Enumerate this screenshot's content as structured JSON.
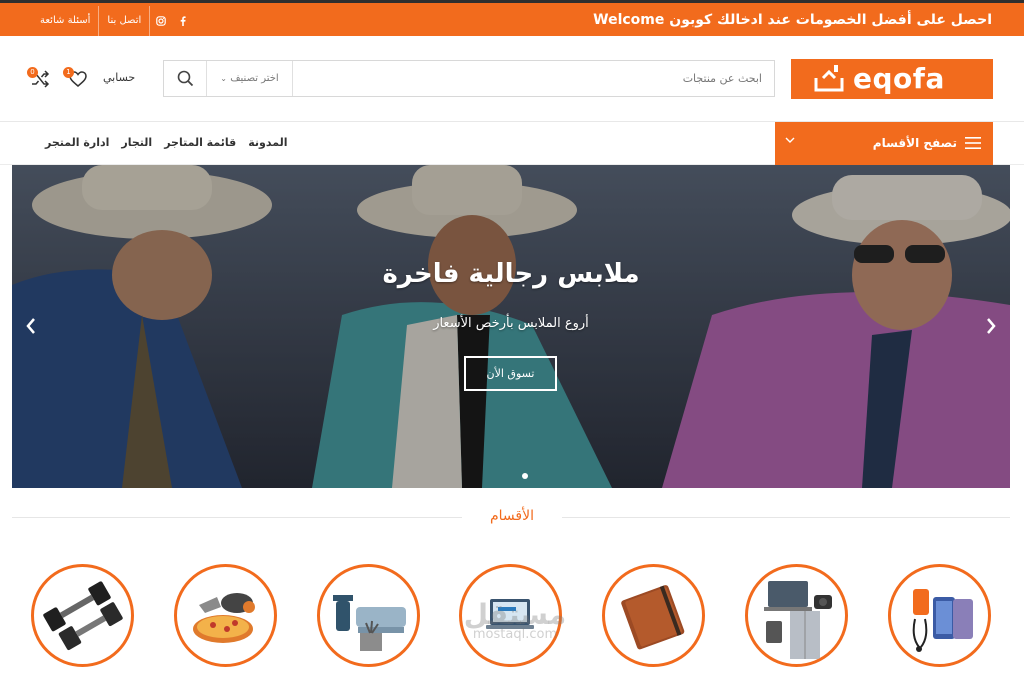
{
  "topbar": {
    "promo": "احصل على أفضل الخصومات عند ادخالك كوبون Welcome",
    "links": [
      "أسئلة شائعة",
      "اتصل بنا"
    ],
    "social_icons": [
      "instagram-icon",
      "facebook-icon"
    ]
  },
  "header": {
    "logo_text": "eqofa",
    "search_placeholder": "ابحث عن منتجات",
    "category_select": "اختر تصنيف",
    "account_label": "حسابي",
    "wishlist_count": "1",
    "compare_count": "0"
  },
  "nav": {
    "browse_label": "تصفح الأقسام",
    "items": [
      "ادارة المتجر",
      "التجار",
      "قائمة المتاجر",
      "المدونة"
    ]
  },
  "hero": {
    "title": "ملابس رجالية فاخرة",
    "subtitle": "أروع الملابس بأرخص الأسعار",
    "cta": "تسوق الأن"
  },
  "sections": {
    "categories_title": "الأقسام"
  },
  "categories": [
    {
      "icon": "phones-accessories-icon"
    },
    {
      "icon": "electronics-appliances-icon"
    },
    {
      "icon": "notebook-icon"
    },
    {
      "icon": "laptop-computer-icon"
    },
    {
      "icon": "home-decor-icon"
    },
    {
      "icon": "food-kitchen-icon"
    },
    {
      "icon": "dumbbells-icon"
    }
  ],
  "watermark": {
    "arabic": "مستقل",
    "latin": "mostaql.com"
  },
  "colors": {
    "accent": "#f26b1d",
    "topbar_border": "#2f2f2f"
  }
}
